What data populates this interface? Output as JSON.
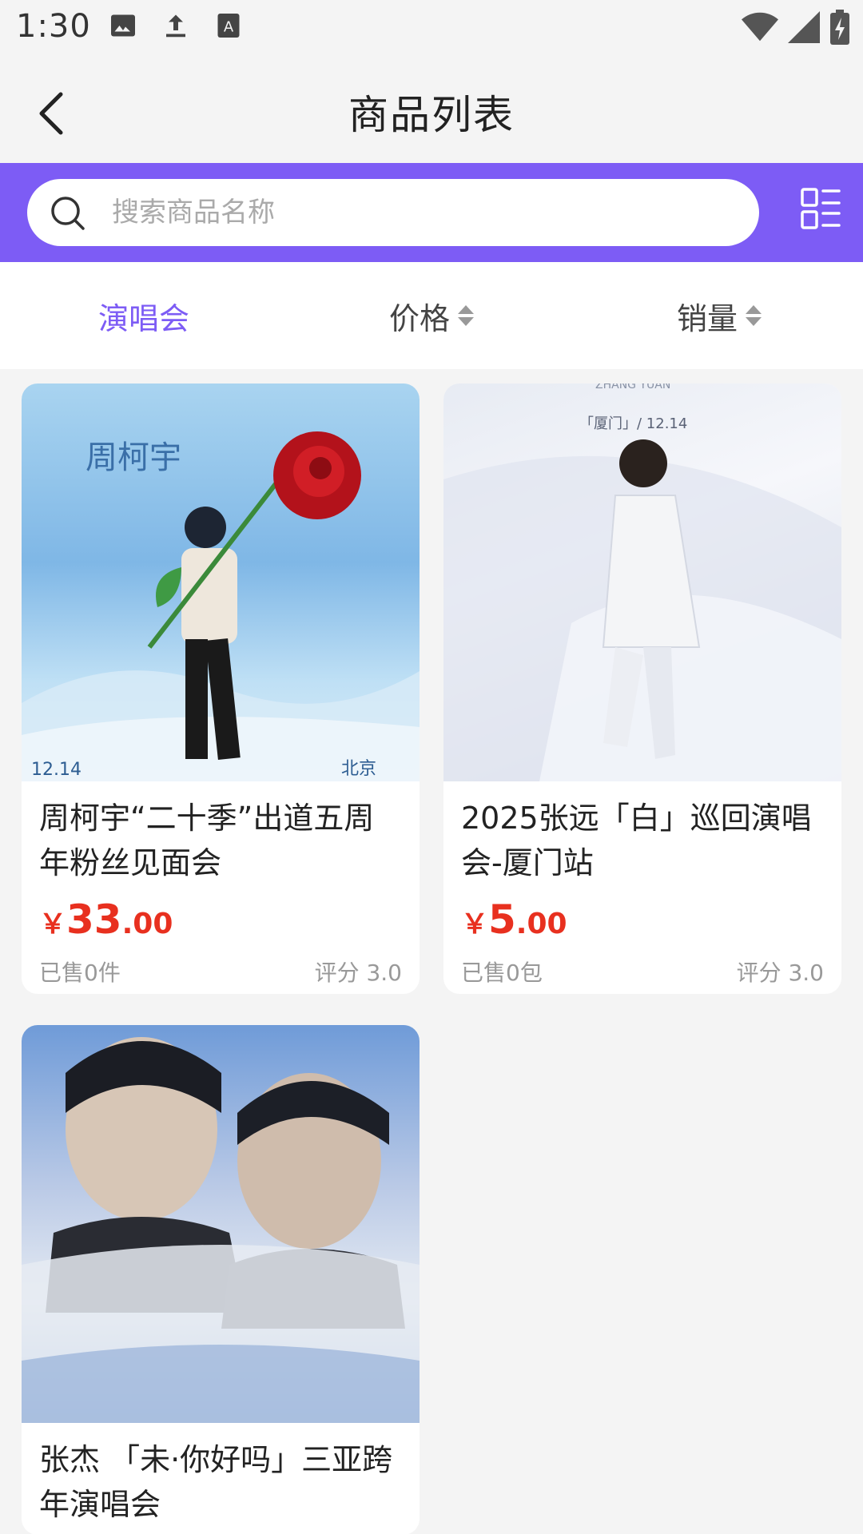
{
  "status_bar": {
    "time": "1:30"
  },
  "header": {
    "title": "商品列表"
  },
  "search": {
    "placeholder": "搜索商品名称",
    "value": ""
  },
  "filters": {
    "tabs": [
      {
        "label": "演唱会"
      },
      {
        "label": "价格"
      },
      {
        "label": "销量"
      }
    ]
  },
  "colors": {
    "accent": "#7d5cf5",
    "price": "#e8301f"
  },
  "products": [
    {
      "title": "周柯宇“二十季”出道五周年粉丝见面会",
      "price_symbol": "￥",
      "price_int": "33",
      "price_dec": ".00",
      "sold": "已售0件",
      "rating": "评分 3.0",
      "poster_text_1": "周柯宇",
      "poster_text_2": "12.14",
      "poster_text_3": "北京"
    },
    {
      "title": "2025张远「白」巡回演唱会-厦门站",
      "price_symbol": "￥",
      "price_int": "5",
      "price_dec": ".00",
      "sold": "已售0包",
      "rating": "评分 3.0",
      "poster_text_1": "ZHANG YUAN",
      "poster_text_2": "「厦门」/ 12.14"
    },
    {
      "title": "张杰 「未·你好吗」三亚跨年演唱会",
      "price_symbol": "",
      "price_int": "",
      "price_dec": "",
      "sold": "",
      "rating": ""
    }
  ]
}
